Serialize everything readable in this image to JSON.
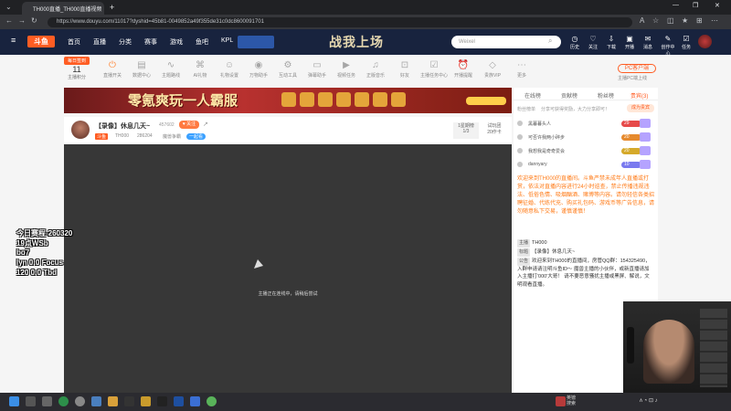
{
  "browser": {
    "tab_title": "TH000直播_TH000直播视频",
    "url": "https://www.douyu.com/11017?dyshid=45b81-0049852a49f355de31c0dc8600091701"
  },
  "site": {
    "logo": "斗鱼",
    "nav": [
      "首页",
      "直播",
      "分类",
      "赛事",
      "游戏",
      "鱼吧",
      "KPL"
    ],
    "banner_text": "战我上场",
    "search_placeholder": "Weixel",
    "header_icons": [
      "历史",
      "关注",
      "下载",
      "开播",
      "消息",
      "创作中心",
      "任务"
    ]
  },
  "toolbar": {
    "daily_card": {
      "top": "每日签到",
      "number": "11",
      "label": "主播积分"
    },
    "tools": [
      "直播开关",
      "数据中心",
      "主题路线",
      "AI礼物",
      "礼物设置",
      "万物助手",
      "互动工具",
      "弹幕助手",
      "视频任务",
      "正版音乐",
      "好友",
      "主播任务中心",
      "开播提醒",
      "贵族VIP",
      "更多"
    ],
    "pc_button": "PC客户端",
    "pc_sub": "主播PC端上线"
  },
  "ad": {
    "text": "零氪爽玩一人霸服"
  },
  "room": {
    "title": "【录像】休息几天~",
    "view_count": "457602",
    "follow_label": "关注",
    "tag": "斗鱼",
    "name": "TH000",
    "room_id": "286204",
    "category": "魔兽争霸",
    "tag_right": "一起看",
    "rank_label": "1星期榜",
    "rank_value": "1/3",
    "card_label": "试玩团",
    "card_value": "20作卡"
  },
  "player": {
    "status_text": "主播正在连线中，请稍后尝试"
  },
  "chat": {
    "tabs": [
      "在线榜",
      "贡献榜",
      "粉丝榜",
      "贵宾(3)"
    ],
    "sub_left": "粉丝榜单",
    "sub_mid": "分享可获得奖励，大力分享即可！",
    "sub_button": "成为贵宾",
    "rank_rows": [
      {
        "name": "黑暮暮头人",
        "level": "29",
        "color": "#e64a4a"
      },
      {
        "name": "可否许我两小碎步",
        "level": "20",
        "color": "#e68a2e"
      },
      {
        "name": "我想我是奇奇爱会",
        "level": "20",
        "color": "#d5a92a"
      },
      {
        "name": "dannyary",
        "level": "10",
        "color": "#7a7aef"
      }
    ],
    "notice": "欢迎来到TH000的直播间。斗鱼严禁未成年人直播或打赏，依法对直播内容进行24小时巡查，禁止传播违规违法、低俗色情、吸烟酗酒、赌博等内容。请勿轻信各类招聘征婚、代练代充、购买礼包码、游戏币等广告信息，请勿随意私下交易，谨慎谨慎！",
    "msg1_tag": "主播",
    "msg1_text": "TH000",
    "msg2_tag": "标题",
    "msg2_text": "【录像】休息几天~",
    "msg3_tag": "公告",
    "msg3_text": "欢迎来到TH000的直播间，房管QQ群：154325490，入群申请请注明斗鱼ID～ 魔兽主播的小伙伴，或新直播请加入主播打'000'大哥！ 请不要恶意骚扰主播或黑屏、解说，文明观看直播。"
  },
  "overlay": [
    "今日赛程-260320",
    "19点WSb",
    "bo7",
    "lyn 0:0 Focus",
    "120 0:0 Tbd"
  ],
  "taskbar": {
    "weather_line1": "英镑",
    "weather_line2": "搜索",
    "time_line1": "",
    "time_line2": ""
  }
}
